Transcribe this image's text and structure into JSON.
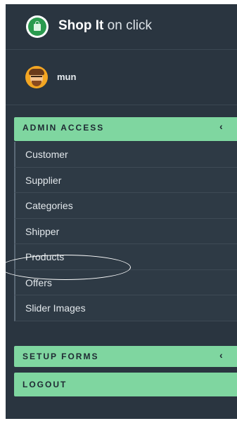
{
  "brand": {
    "strong": "Shop It",
    "rest": "on click",
    "logo_icon": "shopping-bag-icon"
  },
  "user": {
    "name": "mun",
    "avatar_icon": "avatar"
  },
  "sections": {
    "admin_access": "ADMIN ACCESS",
    "setup_forms": "SETUP FORMS",
    "logout": "LOGOUT"
  },
  "admin_menu": [
    {
      "label": "Customer"
    },
    {
      "label": "Supplier"
    },
    {
      "label": "Categories"
    },
    {
      "label": "Shipper"
    },
    {
      "label": "Products"
    },
    {
      "label": "Offers"
    },
    {
      "label": "Slider Images"
    }
  ],
  "chevron_glyph": "‹",
  "colors": {
    "sidebar_bg": "#2a3540",
    "section_bg": "#7fd6a0",
    "menu_item_bg": "#2e3a45",
    "text": "#e3e8ec"
  }
}
